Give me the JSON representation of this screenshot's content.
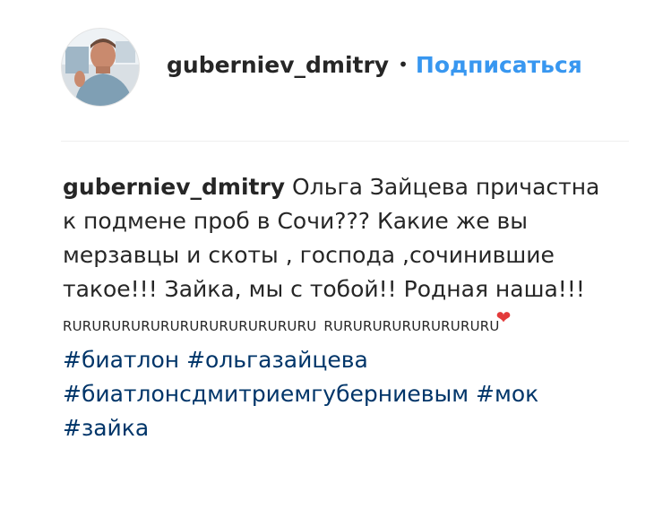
{
  "header": {
    "username": "guberniev_dmitry",
    "separator": "•",
    "follow_label": "Подписаться"
  },
  "caption": {
    "username": "guberniev_dmitry",
    "text_1": "Ольга Зайцева причастна к подмене проб в Сочи??? Какие же вы мерзавцы и скоты , господа ,сочинившие такое!!! Зайка, мы с тобой!! Родная наша!!! ",
    "ru_line_1": "RURURURURURURURURURURURURU",
    "ru_line_2": "RURURURURURURURURU",
    "heart_emoji": "❤",
    "hashtags": [
      "#биатлон",
      "#ольгазайцева",
      "#биатлонсдмитриемгуберниевым",
      "#мок",
      "#зайка"
    ]
  },
  "colors": {
    "link_blue": "#3897f0",
    "hashtag_blue": "#003569",
    "text": "#262626",
    "divider": "#efefef"
  },
  "icons": {
    "avatar": "profile-photo",
    "heart": "red-heart-emoji"
  }
}
